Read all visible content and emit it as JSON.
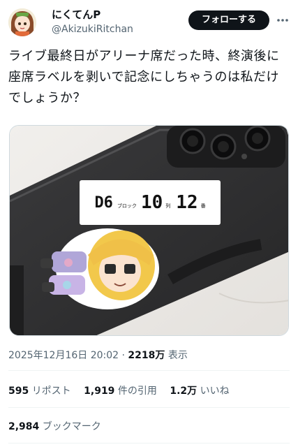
{
  "user": {
    "display_name": "にくてんP",
    "handle": "@AkizukiRitchan"
  },
  "header": {
    "follow_label": "フォローする",
    "more_icon": "more-dots-icon"
  },
  "tweet": {
    "text": "ライブ最終日がアリーナ席だった時、終演後に座席ラベルを剥いで記念にしちゃうのは私だけでしょうか？"
  },
  "media": {
    "label": {
      "block": "D6",
      "block_unit": "ブロック",
      "row": "10",
      "row_unit": "列",
      "seat": "12",
      "seat_unit": "番"
    }
  },
  "meta": {
    "datetime": "2025年12月16日 20:02 · ",
    "views": "2218万",
    "views_label": " 表示"
  },
  "stats": {
    "reposts": "595",
    "reposts_label": "リポスト",
    "quotes": "1,919",
    "quotes_label": "件の引用",
    "likes": "1.2万",
    "likes_label": "いいね"
  },
  "bookmarks": {
    "count": "2,984",
    "label": "ブックマーク"
  },
  "colors": {
    "primary_text": "#0f1419",
    "secondary_text": "#536471",
    "follow_bg": "#0f1419"
  }
}
